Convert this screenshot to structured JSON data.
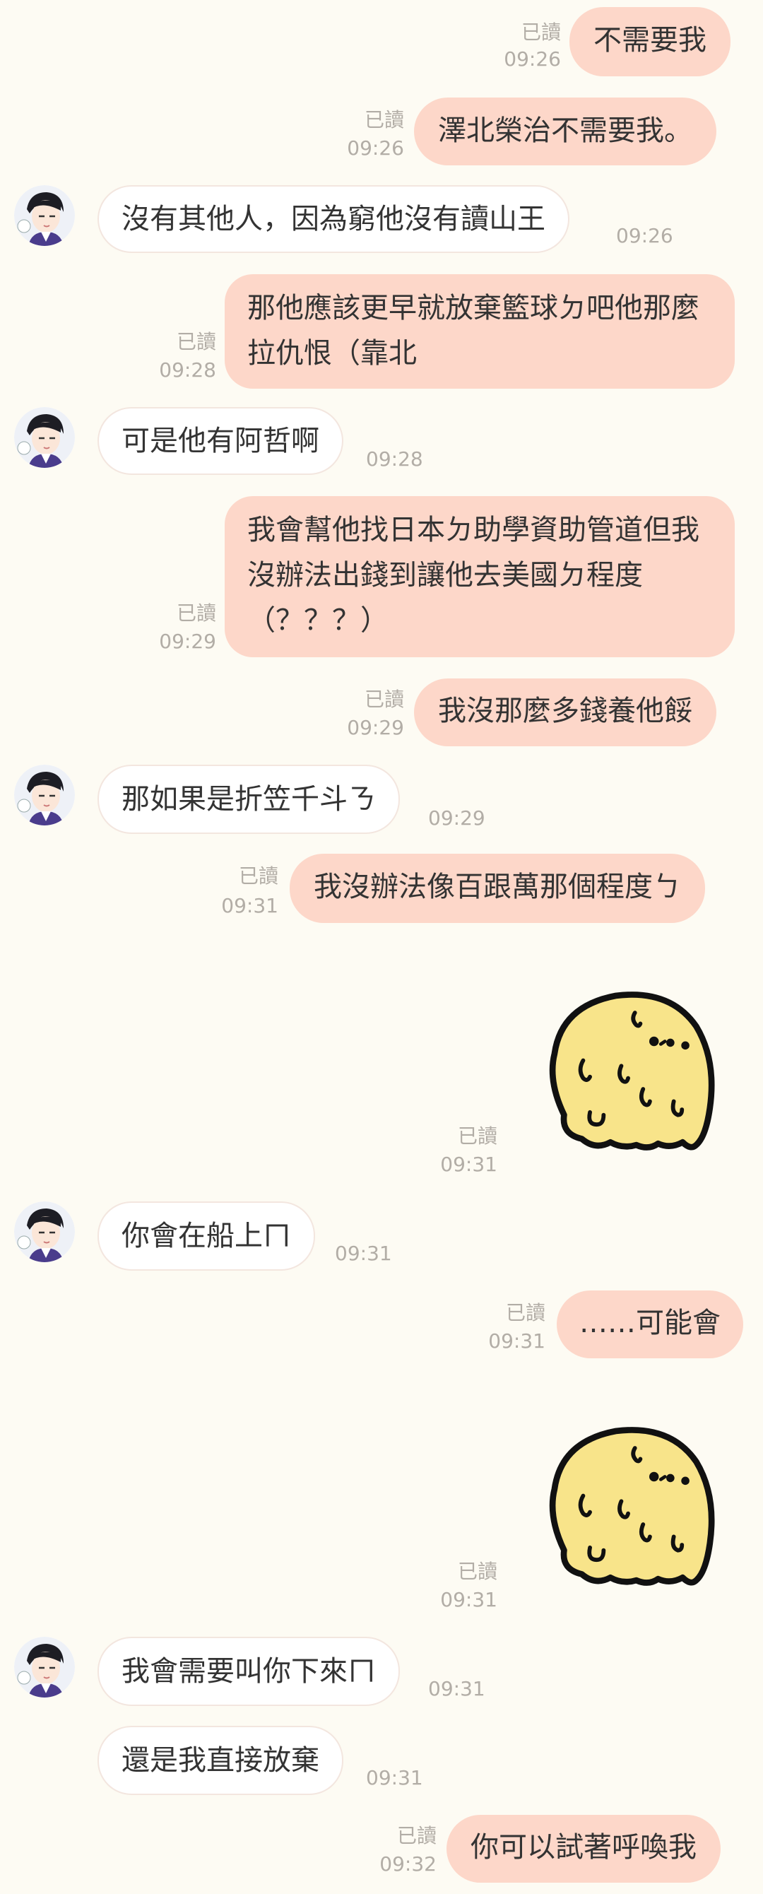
{
  "messages": [
    {
      "id": "m1",
      "side": "out",
      "text": "不需要我",
      "read": "已讀",
      "time": "09:26"
    },
    {
      "id": "m2",
      "side": "out",
      "text": "澤北榮治不需要我。",
      "read": "已讀",
      "time": "09:26"
    },
    {
      "id": "m3",
      "side": "in",
      "text": "沒有其他人，因為窮他沒有讀山王",
      "time": "09:26"
    },
    {
      "id": "m4",
      "side": "out",
      "text": "那他應該更早就放棄籃球ㄉ吧他那麼拉仇恨（靠北",
      "read": "已讀",
      "time": "09:28"
    },
    {
      "id": "m5",
      "side": "in",
      "text": "可是他有阿哲啊",
      "time": "09:28"
    },
    {
      "id": "m6",
      "side": "out",
      "text": "我會幫他找日本ㄉ助學資助管道但我沒辦法出錢到讓他去美國ㄉ程度（？？？）",
      "read": "已讀",
      "time": "09:29"
    },
    {
      "id": "m7",
      "side": "out",
      "text": "我沒那麼多錢養他餒",
      "read": "已讀",
      "time": "09:29"
    },
    {
      "id": "m8",
      "side": "in",
      "text": "那如果是折笠千斗ㄋ",
      "time": "09:29"
    },
    {
      "id": "m9",
      "side": "out",
      "text": "我沒辦法像百跟萬那個程度ㄅ",
      "read": "已讀",
      "time": "09:31"
    },
    {
      "id": "m10",
      "side": "out",
      "sticker": "yellow-blob-sticker",
      "read": "已讀",
      "time": "09:31"
    },
    {
      "id": "m11",
      "side": "in",
      "text": "你會在船上ㄇ",
      "time": "09:31"
    },
    {
      "id": "m12",
      "side": "out",
      "text": "……可能會",
      "read": "已讀",
      "time": "09:31"
    },
    {
      "id": "m13",
      "side": "out",
      "sticker": "yellow-blob-sticker",
      "read": "已讀",
      "time": "09:31"
    },
    {
      "id": "m14",
      "side": "in",
      "text": "我會需要叫你下來ㄇ",
      "time": "09:31"
    },
    {
      "id": "m15",
      "side": "in",
      "text": "還是我直接放棄",
      "time": "09:31"
    },
    {
      "id": "m16",
      "side": "out",
      "text": "你可以試著呼喚我",
      "read": "已讀",
      "time": "09:32"
    }
  ],
  "colors": {
    "background": "#fdfbf3",
    "outgoing": "#fdd7c9",
    "incoming": "#ffffff",
    "meta": "#b2ada6",
    "sticker": "#f8e48a"
  }
}
